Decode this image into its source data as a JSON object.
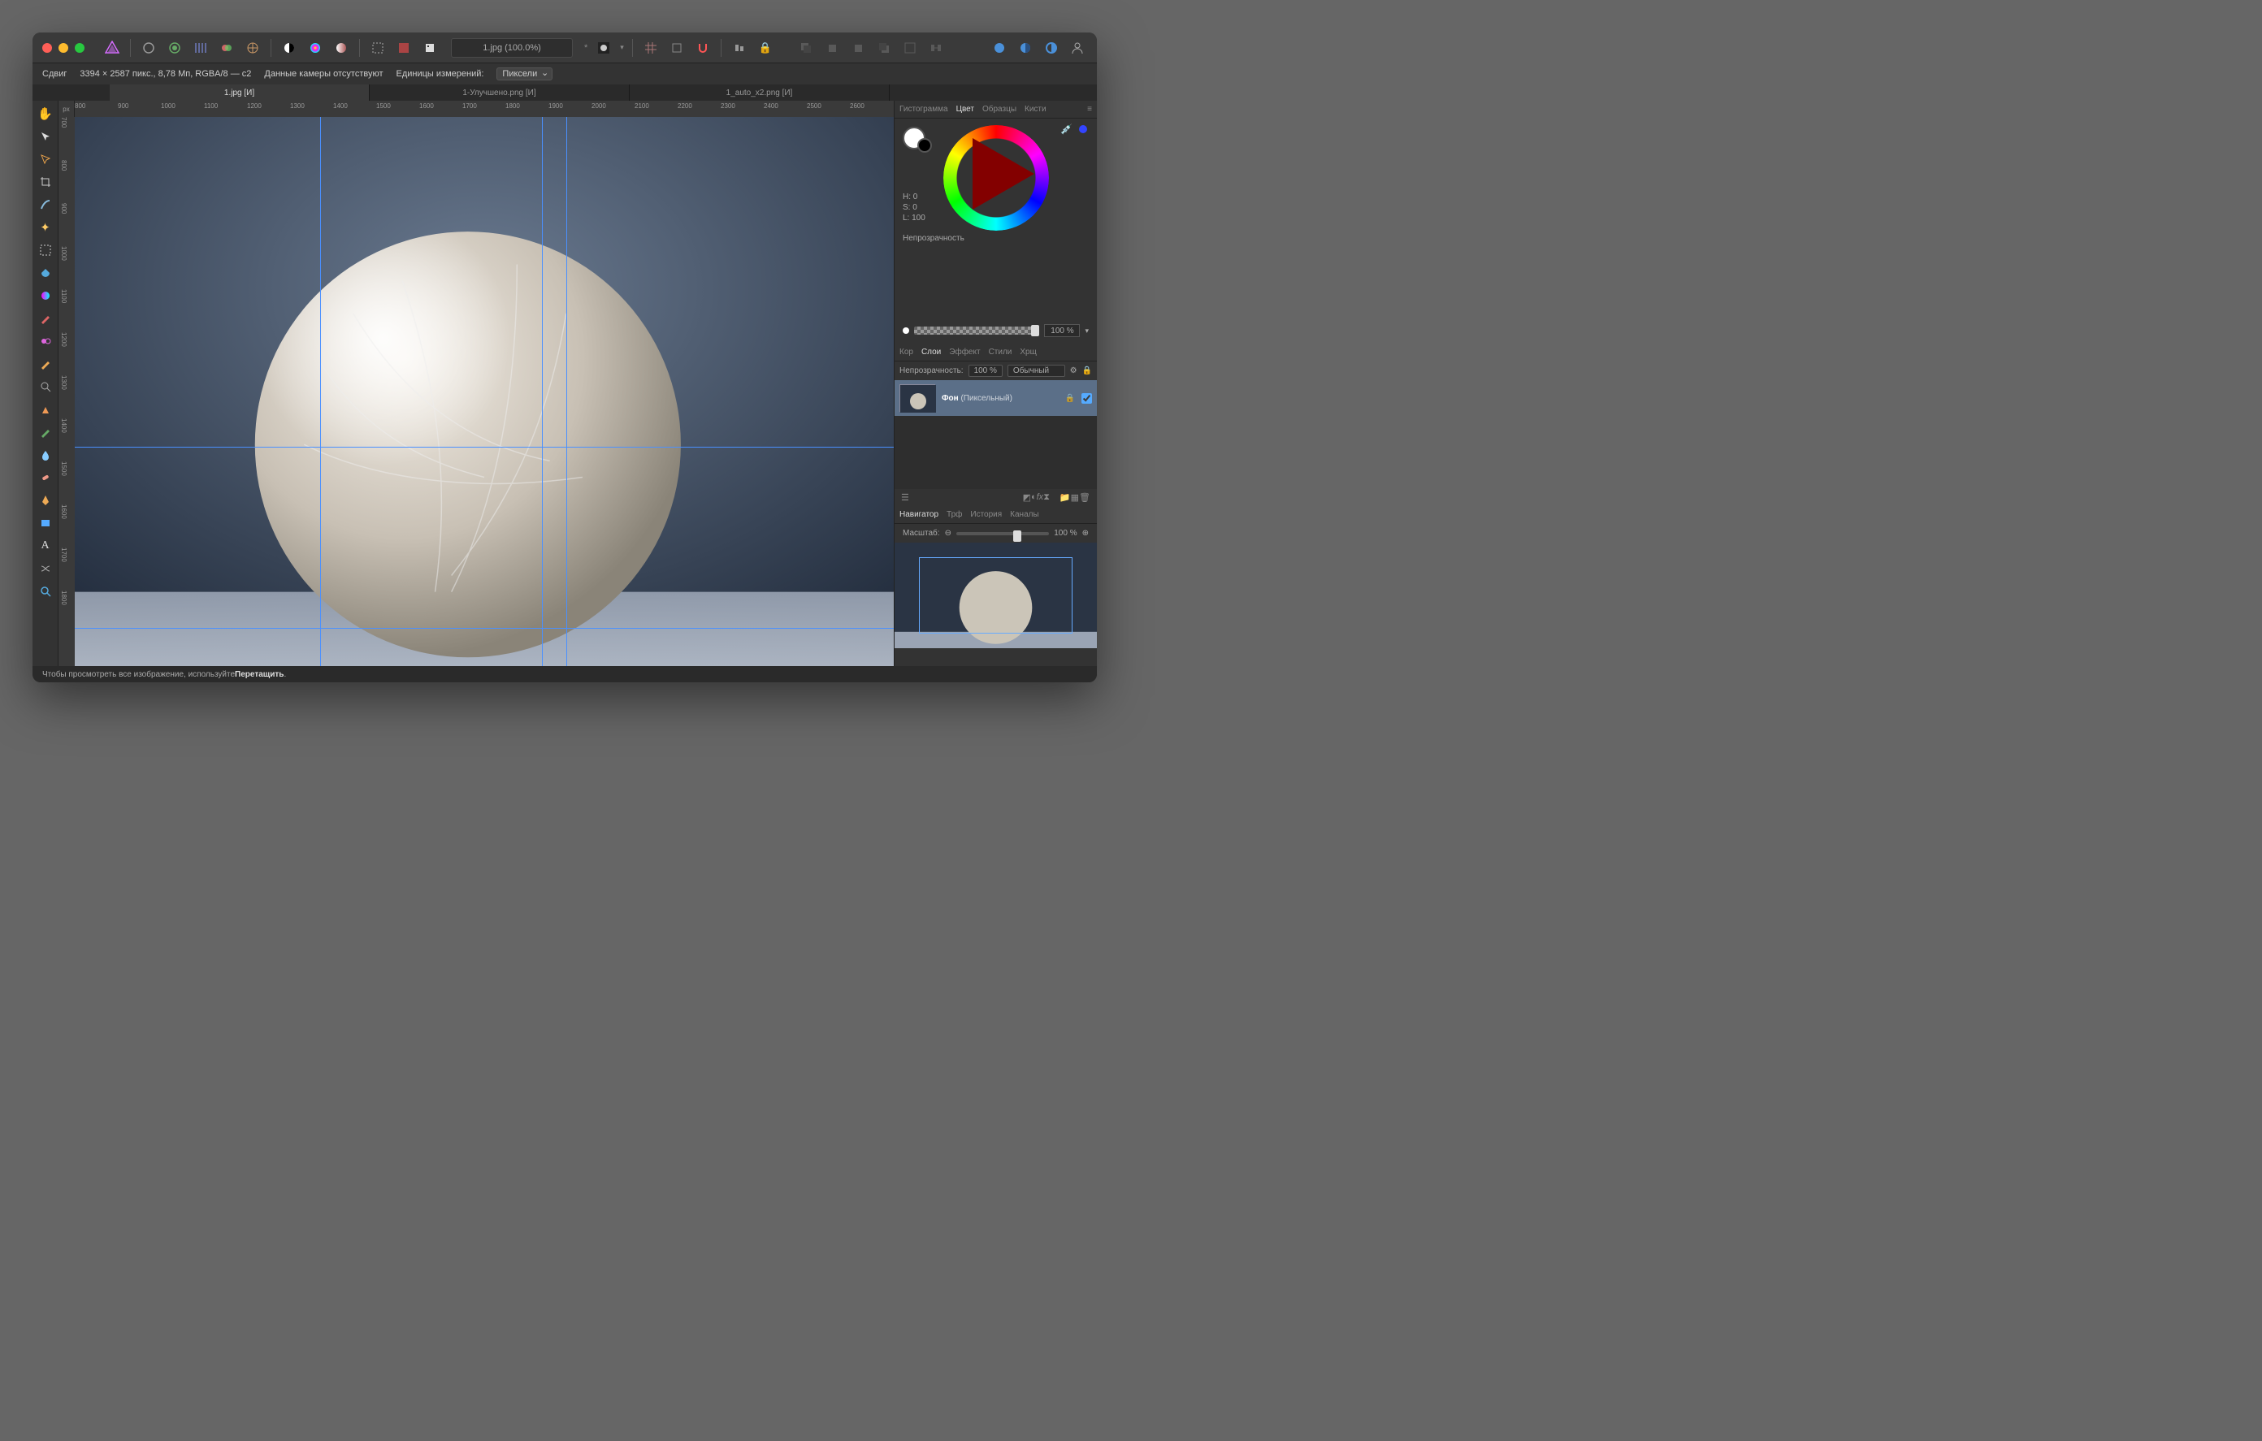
{
  "window": {
    "doc_title": "1.jpg (100.0%)",
    "modified_mark": "*"
  },
  "contextbar": {
    "tool_name": "Сдвиг",
    "dimensions": "3394 × 2587 пикс., 8,78 Мп, RGBA/8 — c2",
    "camera": "Данные камеры отсутствуют",
    "units_label": "Единицы измерений:",
    "units_value": "Пиксели"
  },
  "doc_tabs": [
    {
      "label": "1.jpg [И]",
      "active": true
    },
    {
      "label": "1-Улучшено.png [И]",
      "active": false
    },
    {
      "label": "1_auto_x2.png [И]",
      "active": false
    }
  ],
  "ruler": {
    "unit_label": "px",
    "h_ticks": [
      "800",
      "900",
      "1000",
      "1100",
      "1200",
      "1300",
      "1400",
      "1500",
      "1600",
      "1700",
      "1800",
      "1900",
      "2000",
      "2100",
      "2200",
      "2300",
      "2400",
      "2500",
      "2600"
    ],
    "v_ticks": [
      "700",
      "800",
      "900",
      "1000",
      "1100",
      "1200",
      "1300",
      "1400",
      "1500",
      "1600",
      "1700",
      "1800"
    ]
  },
  "right_tabs_top": [
    "Гистограмма",
    "Цвет",
    "Образцы",
    "Кисти"
  ],
  "right_tabs_top_active": 1,
  "color": {
    "h": "H: 0",
    "s": "S: 0",
    "l": "L: 100",
    "opacity_label": "Непрозрачность",
    "opacity_value": "100 %"
  },
  "right_tabs_mid": [
    "Кор",
    "Слои",
    "Эффект",
    "Стили",
    "Хрщ"
  ],
  "right_tabs_mid_active": 1,
  "layers": {
    "opacity_label": "Непрозрачность:",
    "opacity_value": "100 %",
    "blend_mode": "Обычный",
    "entry_name": "Фон",
    "entry_kind": "(Пиксельный)"
  },
  "right_tabs_bot": [
    "Навигатор",
    "Трф",
    "История",
    "Каналы"
  ],
  "right_tabs_bot_active": 0,
  "navigator": {
    "zoom_label": "Масштаб:",
    "zoom_value": "100 %"
  },
  "status": {
    "hint_prefix": "Чтобы просмотреть все изображение, используйте ",
    "hint_strong": "Перетащить",
    "hint_suffix": "."
  },
  "tools": [
    "hand",
    "move",
    "view",
    "crop",
    "brush",
    "sparkle",
    "marquee",
    "flood",
    "color",
    "paint",
    "clone",
    "pencil",
    "zoomglass",
    "dodge",
    "inpaint",
    "blur",
    "heal",
    "pen",
    "rectangle",
    "text",
    "mesh",
    "zoom"
  ]
}
